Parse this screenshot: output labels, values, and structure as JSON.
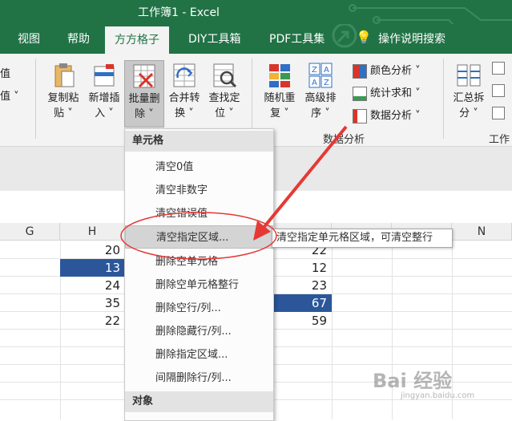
{
  "window": {
    "title": "工作簿1  -  Excel"
  },
  "tabs": [
    {
      "label": "视图"
    },
    {
      "label": "帮助"
    },
    {
      "label": "方方格子",
      "active": true
    },
    {
      "label": "DIY工具箱"
    },
    {
      "label": "PDF工具集"
    },
    {
      "label": "操作说明搜索"
    }
  ],
  "ribbon": {
    "left_cut_1": "值",
    "left_cut_2": "值 ˅",
    "buttons": [
      {
        "line1": "复制粘",
        "line2": "贴 ˅"
      },
      {
        "line1": "新增插",
        "line2": "入 ˅"
      },
      {
        "line1": "批量删",
        "line2": "除 ˅",
        "selected": true
      },
      {
        "line1": "合并转",
        "line2": "换 ˅"
      },
      {
        "line1": "查找定",
        "line2": "位 ˅"
      },
      {
        "line1": "随机重",
        "line2": "复 ˅"
      },
      {
        "line1": "高级排",
        "line2": "序 ˅"
      },
      {
        "line1": "汇总拆",
        "line2": "分 ˅"
      }
    ],
    "small_buttons": [
      {
        "label": "颜色分析 ˅"
      },
      {
        "label": "统计求和 ˅"
      },
      {
        "label": "数据分析 ˅"
      }
    ],
    "group_labels": {
      "data_analysis": "数据分析",
      "work": "工作"
    }
  },
  "columns": [
    {
      "label": "G"
    },
    {
      "label": "H"
    },
    {
      "label": "N"
    }
  ],
  "cells": {
    "h": [
      "20",
      "13",
      "24",
      "35",
      "22"
    ],
    "k": [
      "22",
      "12",
      "23",
      "67",
      "59"
    ]
  },
  "menu": {
    "section1": "单元格",
    "items": [
      {
        "label": "清空0值"
      },
      {
        "label": "清空非数字"
      },
      {
        "label": "清空错误值"
      },
      {
        "label": "清空指定区域...",
        "hover": true
      },
      {
        "label": "删除空单元格"
      },
      {
        "label": "删除空单元格整行"
      },
      {
        "label": "删除空行/列..."
      },
      {
        "label": "删除隐藏行/列..."
      },
      {
        "label": "删除指定区域..."
      },
      {
        "label": "间隔删除行/列..."
      }
    ],
    "section2": "对象"
  },
  "tooltip": {
    "text": "清空指定单元格区域，可清空整行"
  },
  "watermark": {
    "text": "Bai 经验",
    "sub": "jingyan.baidu.com"
  },
  "colors": {
    "excel_green": "#217346",
    "selected_cell": "#2b579a",
    "annotation_red": "#e53935"
  }
}
